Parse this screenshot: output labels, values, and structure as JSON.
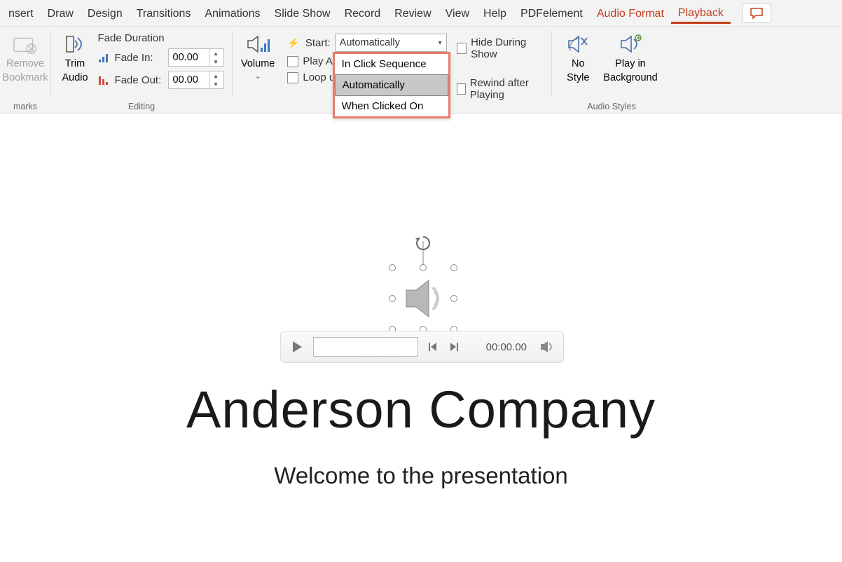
{
  "tabs": {
    "insert": "nsert",
    "draw": "Draw",
    "design": "Design",
    "transitions": "Transitions",
    "animations": "Animations",
    "slideshow": "Slide Show",
    "record": "Record",
    "review": "Review",
    "view": "View",
    "help": "Help",
    "pdfelement": "PDFelement",
    "audioformat": "Audio Format",
    "playback": "Playback"
  },
  "groups": {
    "bookmarks": "marks",
    "editing": "Editing",
    "audiostyles": "Audio Styles"
  },
  "buttons": {
    "remove_bookmark_line1": "Remove",
    "remove_bookmark_line2": "Bookmark",
    "trim_audio_line1": "Trim",
    "trim_audio_line2": "Audio",
    "volume": "Volume",
    "nostyle_line1": "No",
    "nostyle_line2": "Style",
    "playbg_line1": "Play in",
    "playbg_line2": "Background"
  },
  "fade": {
    "title": "Fade Duration",
    "in_label": "Fade In:",
    "out_label": "Fade Out:",
    "in_value": "00.00",
    "out_value": "00.00"
  },
  "options": {
    "start_label": "Start:",
    "start_value": "Automatically",
    "dropdown_opt1": "In Click Sequence",
    "dropdown_opt2": "Automatically",
    "dropdown_opt3": "When Clicked On",
    "play_across": "Play A",
    "loop": "Loop u",
    "hide_during": "Hide During Show",
    "rewind": "Rewind after Playing"
  },
  "player": {
    "time": "00:00.00"
  },
  "slide": {
    "title": "Anderson Company",
    "subtitle": "Welcome to the presentation"
  }
}
